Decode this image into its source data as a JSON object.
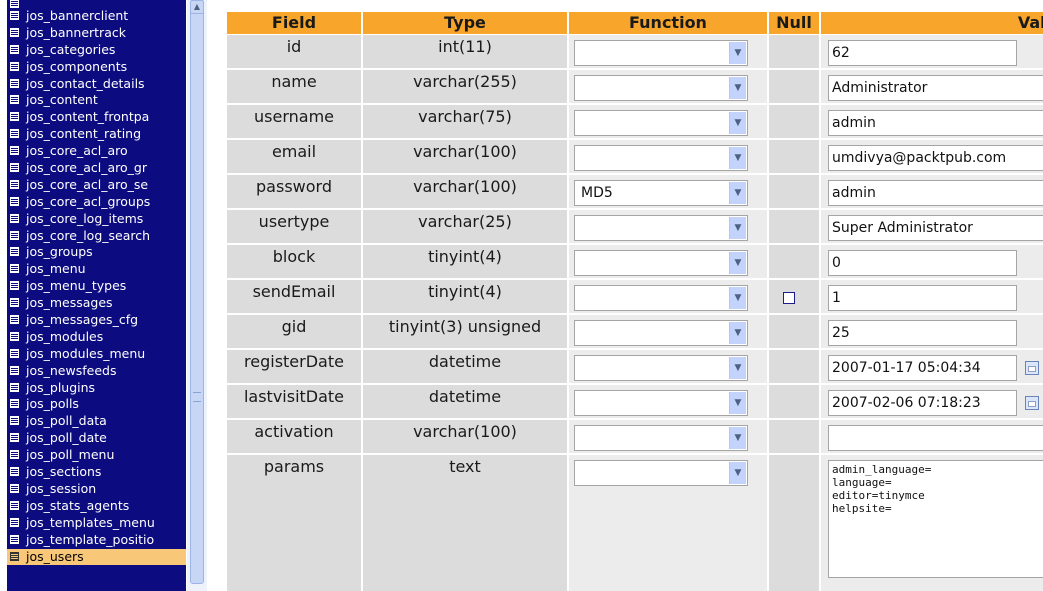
{
  "sidebar": {
    "tables": [
      "jos_bannerclient",
      "jos_bannertrack",
      "jos_categories",
      "jos_components",
      "jos_contact_details",
      "jos_content",
      "jos_content_frontpa",
      "jos_content_rating",
      "jos_core_acl_aro",
      "jos_core_acl_aro_gr",
      "jos_core_acl_aro_se",
      "jos_core_acl_groups",
      "jos_core_log_items",
      "jos_core_log_search",
      "jos_groups",
      "jos_menu",
      "jos_menu_types",
      "jos_messages",
      "jos_messages_cfg",
      "jos_modules",
      "jos_modules_menu",
      "jos_newsfeeds",
      "jos_plugins",
      "jos_polls",
      "jos_poll_data",
      "jos_poll_date",
      "jos_poll_menu",
      "jos_sections",
      "jos_session",
      "jos_stats_agents",
      "jos_templates_menu",
      "jos_template_positio",
      "jos_users"
    ],
    "selected": "jos_users"
  },
  "columns": {
    "field": "Field",
    "type": "Type",
    "function": "Function",
    "null": "Null",
    "value": "Valu"
  },
  "rows": [
    {
      "field": "id",
      "type": "int(11)",
      "function": "",
      "null": false,
      "value": "62"
    },
    {
      "field": "name",
      "type": "varchar(255)",
      "function": "",
      "null": false,
      "value": "Administrator"
    },
    {
      "field": "username",
      "type": "varchar(75)",
      "function": "",
      "null": false,
      "value": "admin"
    },
    {
      "field": "email",
      "type": "varchar(100)",
      "function": "",
      "null": false,
      "value": "umdivya@packtpub.com"
    },
    {
      "field": "password",
      "type": "varchar(100)",
      "function": "MD5",
      "null": false,
      "value": "admin"
    },
    {
      "field": "usertype",
      "type": "varchar(25)",
      "function": "",
      "null": false,
      "value": "Super Administrator"
    },
    {
      "field": "block",
      "type": "tinyint(4)",
      "function": "",
      "null": false,
      "value": "0"
    },
    {
      "field": "sendEmail",
      "type": "tinyint(4)",
      "function": "",
      "null": true,
      "value": "1"
    },
    {
      "field": "gid",
      "type": "tinyint(3) unsigned",
      "function": "",
      "null": false,
      "value": "25"
    },
    {
      "field": "registerDate",
      "type": "datetime",
      "function": "",
      "null": false,
      "value": "2007-01-17 05:04:34"
    },
    {
      "field": "lastvisitDate",
      "type": "datetime",
      "function": "",
      "null": false,
      "value": "2007-02-06 07:18:23"
    },
    {
      "field": "activation",
      "type": "varchar(100)",
      "function": "",
      "null": false,
      "value": ""
    },
    {
      "field": "params",
      "type": "text",
      "function": "",
      "null": false,
      "value": "admin_language=\nlanguage=\neditor=tinymce\nhelpsite="
    }
  ],
  "colors": {
    "header": "#f8a52b",
    "sidebar": "#0c0c80",
    "selected": "#f9c778"
  }
}
